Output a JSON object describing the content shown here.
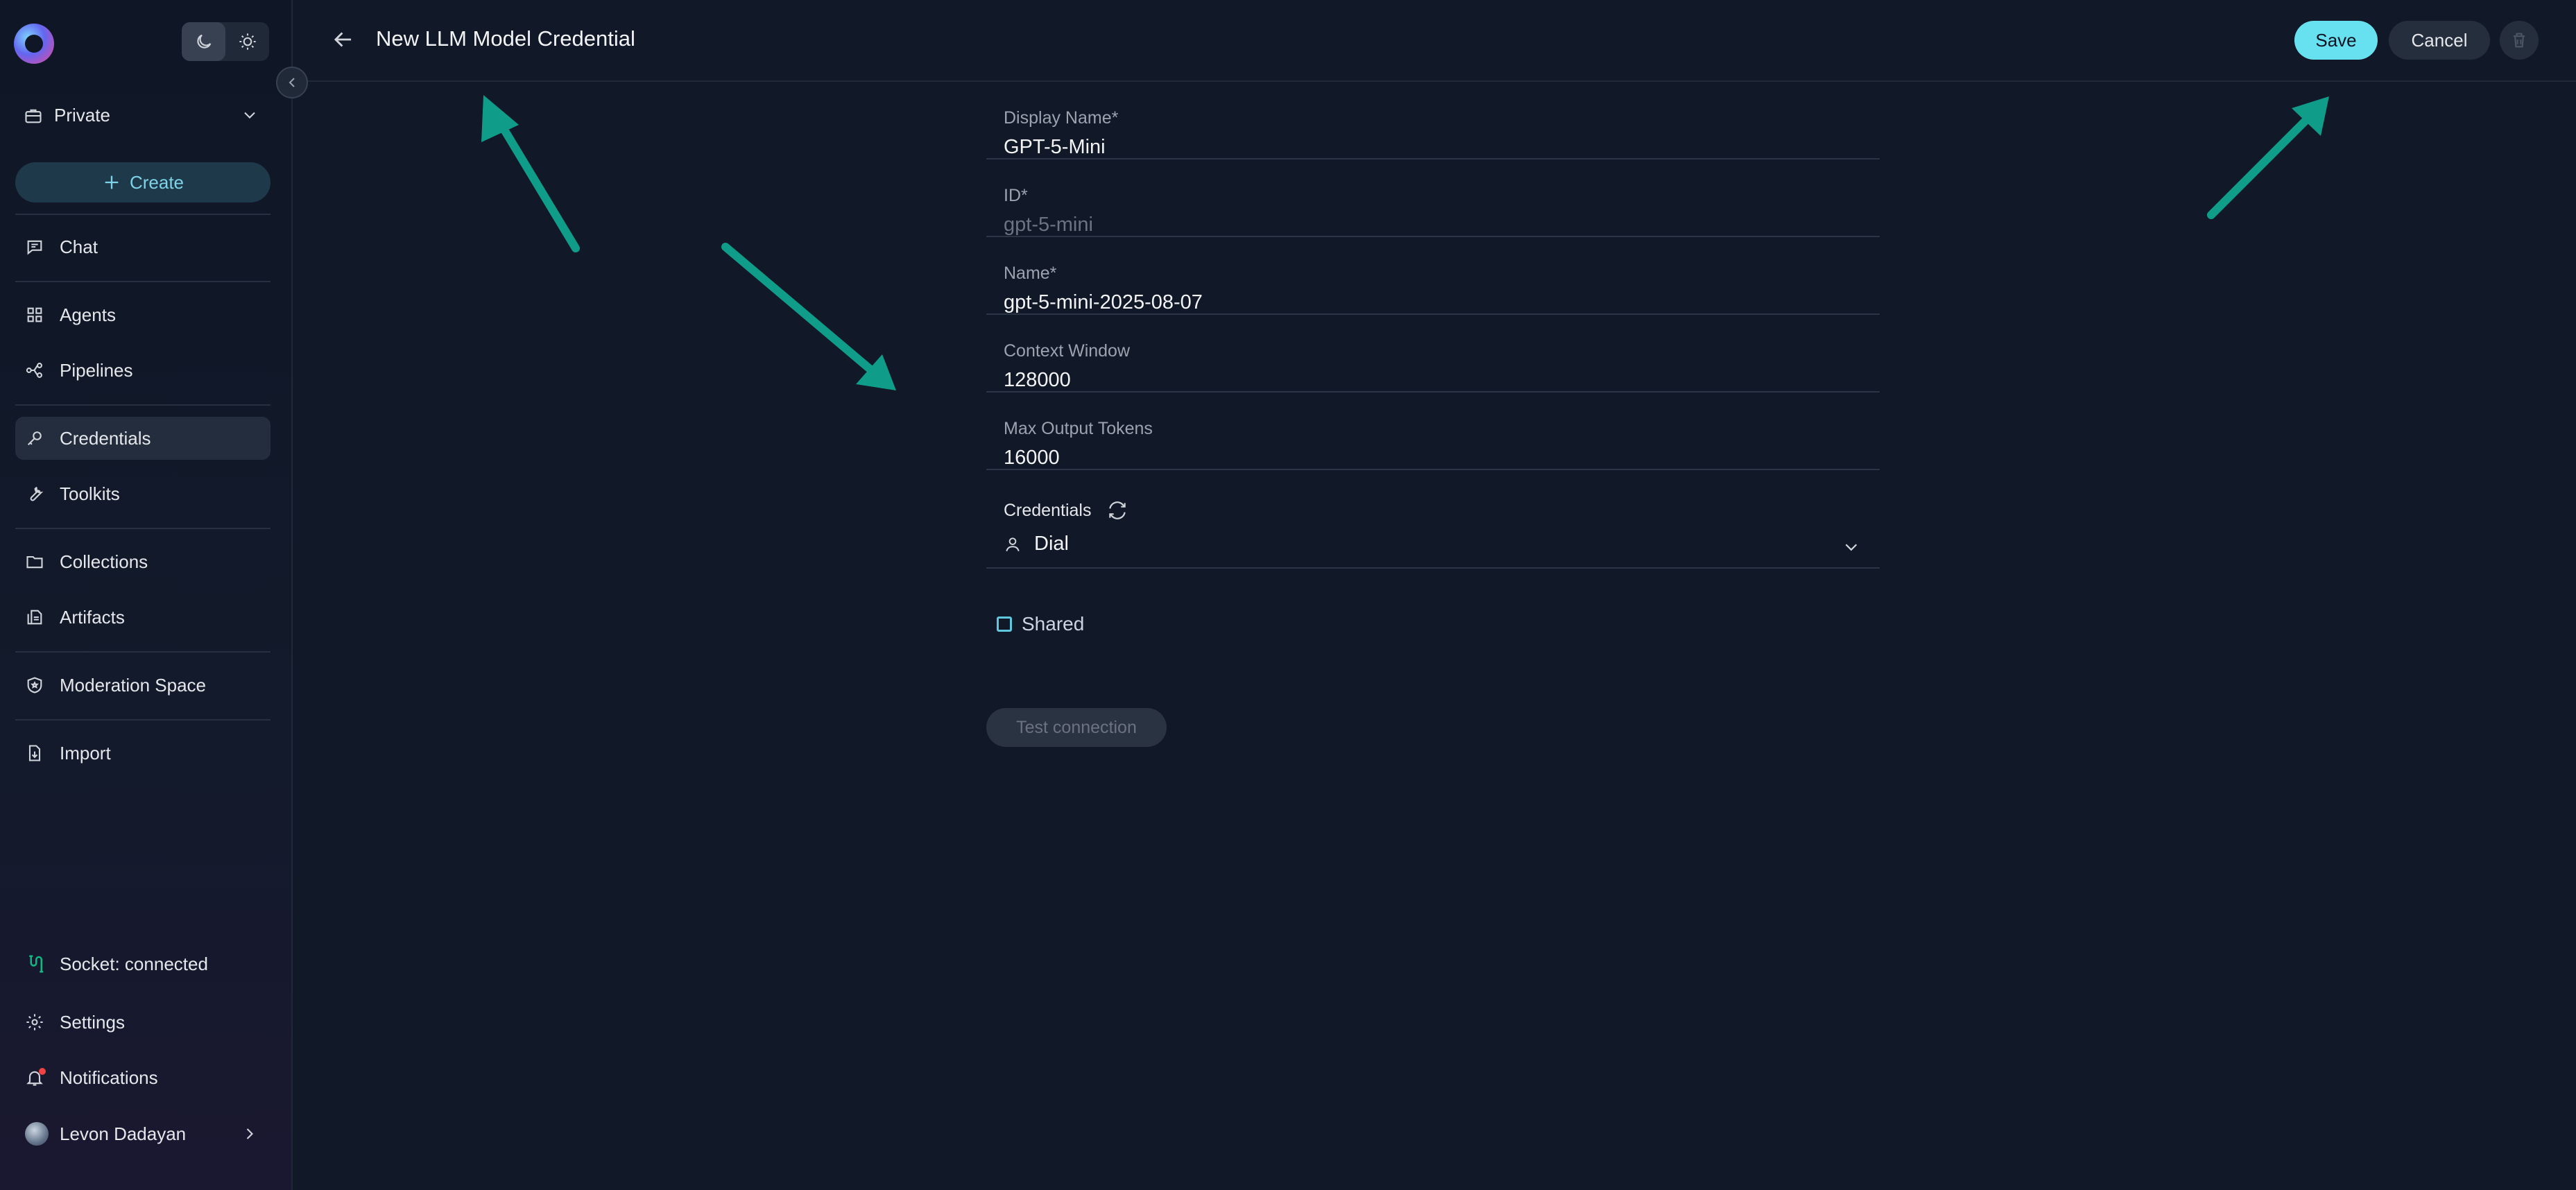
{
  "sidebar": {
    "project": "Private",
    "create_label": "Create",
    "nav": [
      {
        "label": "Chat",
        "icon": "chat-icon"
      },
      {
        "label": "Agents",
        "icon": "grid-icon"
      },
      {
        "label": "Pipelines",
        "icon": "pipeline-icon"
      },
      {
        "label": "Credentials",
        "icon": "key-icon",
        "active": true
      },
      {
        "label": "Toolkits",
        "icon": "wrench-icon"
      },
      {
        "label": "Collections",
        "icon": "folder-icon"
      },
      {
        "label": "Artifacts",
        "icon": "files-icon"
      },
      {
        "label": "Moderation Space",
        "icon": "shield-icon"
      },
      {
        "label": "Import",
        "icon": "import-icon"
      }
    ],
    "socket_status": "Socket: connected",
    "settings": "Settings",
    "notifications": "Notifications",
    "user_name": "Levon Dadayan"
  },
  "header": {
    "title": "New LLM Model Credential",
    "save": "Save",
    "cancel": "Cancel"
  },
  "form": {
    "display_name": {
      "label": "Display Name*",
      "value": "GPT-5-Mini"
    },
    "id": {
      "label": "ID*",
      "value": "gpt-5-mini"
    },
    "name": {
      "label": "Name*",
      "value": "gpt-5-mini-2025-08-07"
    },
    "context_window": {
      "label": "Context Window",
      "value": "128000"
    },
    "max_output_tokens": {
      "label": "Max Output Tokens",
      "value": "16000"
    },
    "credentials": {
      "label": "Credentials",
      "value": "Dial"
    },
    "shared_label": "Shared",
    "shared_checked": false,
    "test_connection": "Test connection"
  },
  "colors": {
    "background": "#111827",
    "accent": "#67e0f0",
    "arrow": "#0f9d8a",
    "socket_ok": "#10b981"
  }
}
